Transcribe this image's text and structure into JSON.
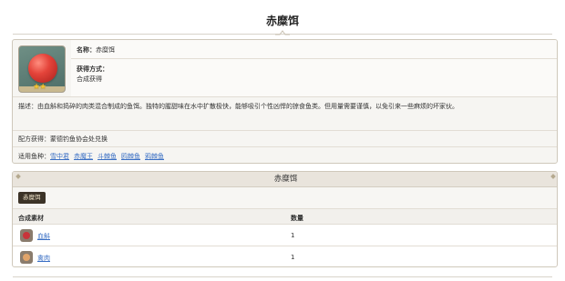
{
  "page": {
    "title": "赤糜饵"
  },
  "info": {
    "name_label": "名称：",
    "name_value": "赤糜饵",
    "source_label": "获得方式：",
    "source_value": "合成获得",
    "rarity_stars": "★★",
    "description": "描述：由血斛和捣碎的肉类混合制成的鱼饵。独特的腥甜味在水中扩散极快，能够吸引个性凶悍的掠食鱼类。但用量需要谨慎，以免引来一些麻烦的坏家伙。",
    "recipe": "配方获得：蒙德钓鱼协会处兑换",
    "fish_label": "适用鱼种：",
    "fish": [
      "雪中君",
      "赤魔王",
      "斗棘鱼",
      "鸥棘鱼",
      "鸦棘鱼"
    ]
  },
  "craft": {
    "header": "赤糜饵",
    "tag": "赤糜饵",
    "col_material": "合成素材",
    "col_qty": "数量",
    "rows": [
      {
        "name": "血斛",
        "qty": "1",
        "icon": "blood-flower-icon",
        "color": "#c8343a"
      },
      {
        "name": "禽肉",
        "qty": "1",
        "icon": "fowl-meat-icon",
        "color": "#e0a46a"
      }
    ]
  },
  "colors": {
    "link": "#3a6fc4",
    "tag_bg": "#3c3327",
    "header_bg": "#e9e4dc"
  }
}
